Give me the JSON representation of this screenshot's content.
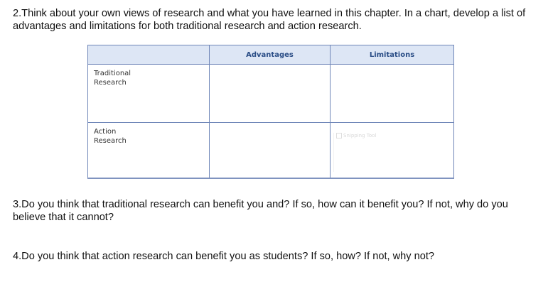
{
  "questions": {
    "q2": "2.Think about your own views of research and what you have learned in this chapter. In a chart, develop a list of advantages and limitations for both traditional research and action research.",
    "q3": "3.Do you think that traditional research can benefit you and? If so, how can it benefit you? If not, why do you believe that it cannot?",
    "q4": "4.Do you think that action research can benefit you as students? If so, how? If not, why not?"
  },
  "chart_table": {
    "headers": [
      "",
      "Advantages",
      "Limitations"
    ],
    "rows": [
      {
        "label_line1": "Traditional",
        "label_line2": "Research"
      },
      {
        "label_line1": "Action",
        "label_line2": "Research"
      }
    ]
  },
  "faded_overlay": {
    "text": "Snipping Tool",
    "icon": "scissors-icon"
  }
}
